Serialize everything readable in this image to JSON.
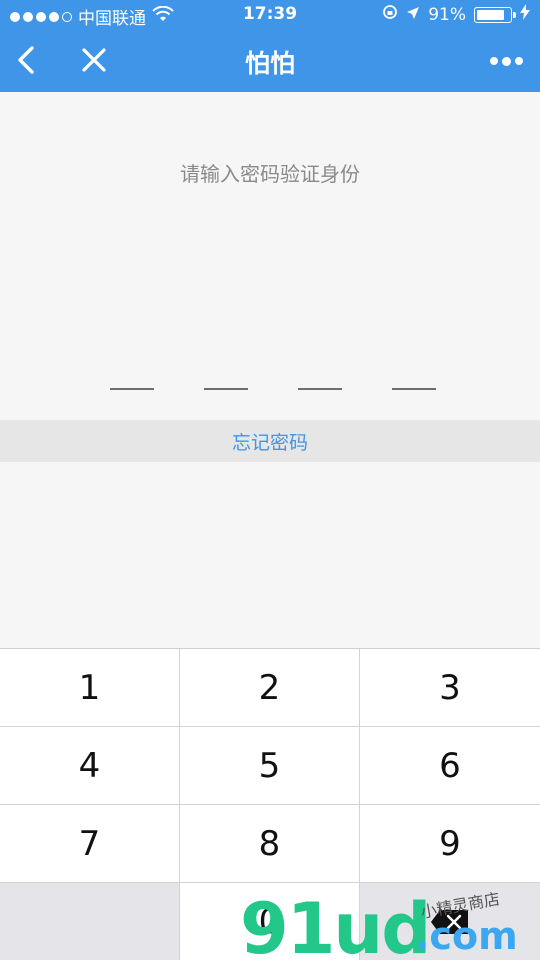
{
  "status_bar": {
    "carrier": "中国联通",
    "time": "17:39",
    "battery_percent": "91%",
    "battery_level": 0.91
  },
  "nav": {
    "title": "怕怕"
  },
  "content": {
    "prompt": "请输入密码验证身份",
    "pin_length": 4,
    "forgot_label": "忘记密码"
  },
  "keypad": {
    "keys": [
      "1",
      "2",
      "3",
      "4",
      "5",
      "6",
      "7",
      "8",
      "9",
      "",
      "0",
      "delete"
    ]
  },
  "watermark": {
    "brand": "91ud",
    "tld": ".com",
    "small": "小精灵商店"
  },
  "colors": {
    "accent": "#3f95e8",
    "background": "#f6f6f6"
  }
}
